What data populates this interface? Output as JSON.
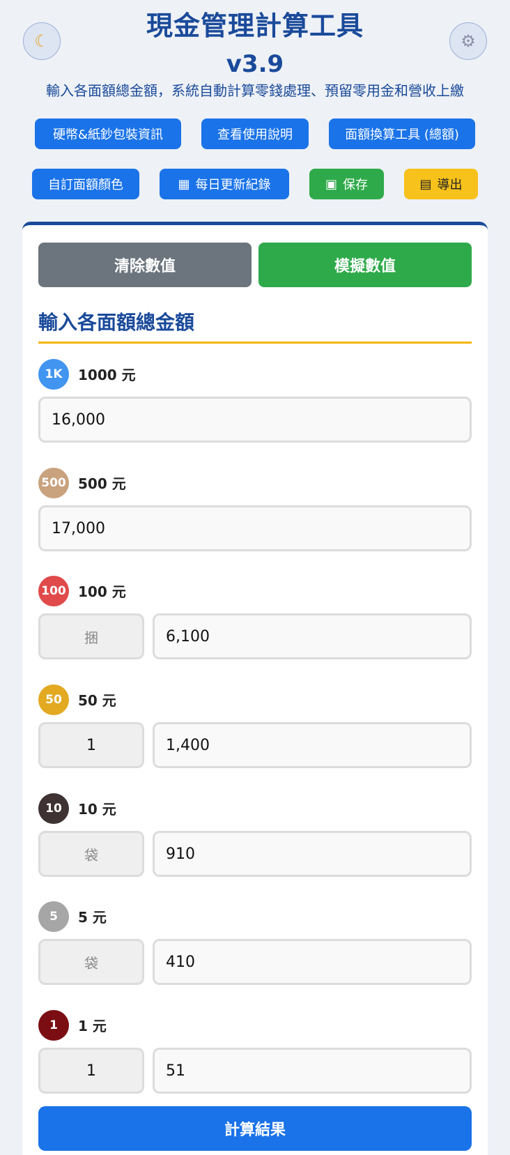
{
  "header": {
    "title": "現金管理計算工具",
    "version": "v3.9",
    "subtitle": "輸入各面額總金額，系統自動計算零錢處理、預留零用金和營收上繳",
    "theme_icon": "moon-icon",
    "settings_icon": "gear-icon"
  },
  "toolbar": {
    "row1": [
      {
        "label": "硬幣&紙鈔包裝資訊",
        "color": "#1a73e8"
      },
      {
        "label": "查看使用說明",
        "color": "#1a73e8"
      },
      {
        "label": "面額換算工具 (總額)",
        "color": "#1a73e8"
      }
    ],
    "row2": [
      {
        "label": "自訂面額顏色",
        "color": "#1a73e8"
      },
      {
        "label": "每日更新紀錄",
        "icon": "calendar-icon",
        "color": "#1a73e8"
      },
      {
        "label": "保存",
        "icon": "floppy-disk-icon",
        "color": "#2eaa4a"
      },
      {
        "label": "導出",
        "icon": "document-icon",
        "color": "#f7c21b"
      }
    ]
  },
  "actions": {
    "clear_label": "清除數值",
    "simulate_label": "模擬數值"
  },
  "section": {
    "title": "輸入各面額總金額",
    "accent_color": "#f4b400"
  },
  "denominations": [
    {
      "badge": "1K",
      "label": "1000 元",
      "badge_color": "#4194f0",
      "amount": "16,000"
    },
    {
      "badge": "500",
      "label": "500 元",
      "badge_color": "#c9a27e",
      "amount": "17,000"
    },
    {
      "badge": "100",
      "label": "100 元",
      "badge_color": "#e04a4a",
      "unit_placeholder": "捆",
      "amount": "6,100"
    },
    {
      "badge": "50",
      "label": "50 元",
      "badge_color": "#e2a921",
      "unit_value": "1",
      "amount": "1,400"
    },
    {
      "badge": "10",
      "label": "10 元",
      "badge_color": "#3e3232",
      "unit_placeholder": "袋",
      "amount": "910"
    },
    {
      "badge": "5",
      "label": "5 元",
      "badge_color": "#a6a6a6",
      "unit_placeholder": "袋",
      "amount": "410"
    },
    {
      "badge": "1",
      "label": "1 元",
      "badge_color": "#7a0e12",
      "unit_value": "1",
      "amount": "51"
    }
  ],
  "calculate_label": "計算結果"
}
